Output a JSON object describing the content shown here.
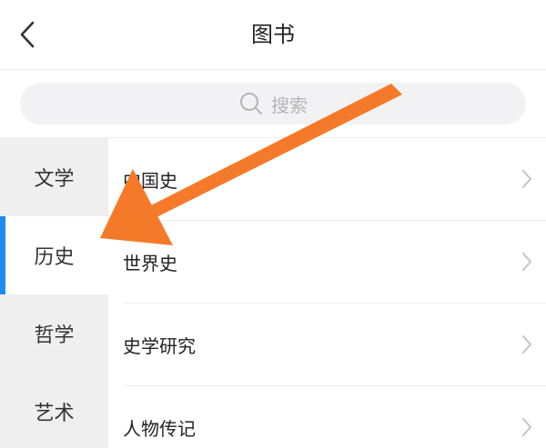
{
  "header": {
    "title": "图书",
    "back_icon": "chevron-left-icon"
  },
  "search": {
    "placeholder": "搜索",
    "icon": "search-icon"
  },
  "sidebar": {
    "active_index": 1,
    "active_color": "#1e8cf0",
    "items": [
      {
        "label": "文学"
      },
      {
        "label": "历史"
      },
      {
        "label": "哲学"
      },
      {
        "label": "艺术"
      }
    ]
  },
  "subcategories": [
    {
      "label": "中国史"
    },
    {
      "label": "世界史"
    },
    {
      "label": "史学研究"
    },
    {
      "label": "人物传记"
    }
  ],
  "annotation": {
    "type": "arrow",
    "color": "#f47a2a",
    "points_to": "历史"
  }
}
